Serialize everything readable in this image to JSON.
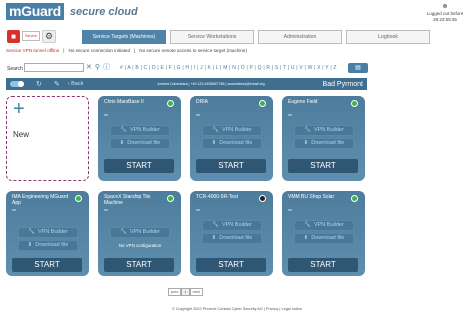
{
  "header": {
    "logo_main": "mGuard",
    "logo_sub": "secure cloud",
    "user_icon": "user-icon",
    "user_status": "Logged out before",
    "user_time": "29:23:59:35"
  },
  "toolbar": {
    "red_button_icon": "stop-icon",
    "service_label": "Service",
    "gear_icon": "gear-icon",
    "tabs": [
      {
        "label": "Service Targets (Machines)",
        "active": true
      },
      {
        "label": "Service Workstations",
        "active": false
      },
      {
        "label": "Administration",
        "active": false
      },
      {
        "label": "Logbook",
        "active": false
      }
    ]
  },
  "statusbar": {
    "items": [
      "Service VPN tunnel offline",
      "No secure connection initiated",
      "No secure remote access to service target (machine)"
    ]
  },
  "filter": {
    "label": "Search",
    "search_value": "",
    "alphabet": "# | A | B | C | D | E | F | G | H | I | J | K | L | M | N | O | P | Q | R | S | T | U | V | W | X | Y | Z"
  },
  "bluebar": {
    "back_label": "Back",
    "contact": "Andrea Colombara | +49 123 4455667788 | acolombera@email.org",
    "city": "Bad Pyrmont"
  },
  "new_card": {
    "label": "New"
  },
  "cards": [
    {
      "title": "Chris MarsBase II",
      "sub": "sn",
      "status": "green",
      "vpn_builder": "VPN Builder",
      "download": "Download file",
      "info": "",
      "start": "START"
    },
    {
      "title": "DRIA",
      "sub": "sn",
      "status": "green",
      "vpn_builder": "VPN Builder",
      "download": "Download file",
      "info": "",
      "start": "START"
    },
    {
      "title": "Eugene Field",
      "sub": "sn",
      "status": "green",
      "vpn_builder": "VPN Builder",
      "download": "Download file",
      "info": "",
      "start": "START"
    },
    {
      "title": "IMA Engineering MGuard App",
      "sub": "sn",
      "status": "green",
      "vpn_builder": "VPN Builder",
      "download": "Download file",
      "info": "",
      "start": "START"
    },
    {
      "title": "SpaceX Starship Tile Machine",
      "sub": "sn",
      "status": "green",
      "vpn_builder": "VPN Builder",
      "download": "",
      "info": "No VPN configuration",
      "start": "START"
    },
    {
      "title": "TCR-4000-5R-Test",
      "sub": "sn",
      "status": "black",
      "vpn_builder": "VPN Builder",
      "download": "Download file",
      "info": "",
      "start": "START"
    },
    {
      "title": "VMM BU Shop Solar",
      "sub": "sn",
      "status": "green",
      "vpn_builder": "VPN Builder",
      "download": "Download file",
      "info": "",
      "start": "START"
    }
  ],
  "pager": {
    "prev": "prev",
    "current": "1",
    "next": "next"
  },
  "footer": {
    "text": "© Copyright 2022 Phoenix Contact Cyber Security AG | Privacy | Legal notice"
  }
}
